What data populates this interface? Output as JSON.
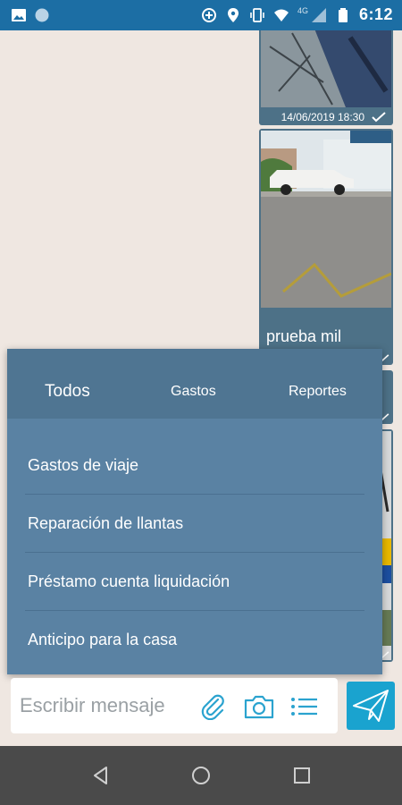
{
  "status_bar": {
    "time": "6:12",
    "network": "4G",
    "icons": [
      "image-icon",
      "circle-icon",
      "data-saver-icon",
      "location-icon",
      "vibrate-icon",
      "wifi-icon",
      "signal-icon",
      "battery-icon"
    ]
  },
  "messages": [
    {
      "type": "photo",
      "timestamp": "14/06/2019 18:30",
      "status": "sent-check"
    },
    {
      "type": "photo",
      "caption": "prueba mil",
      "status": "sent-check"
    },
    {
      "type": "photo",
      "status": "sent-check"
    },
    {
      "type": "photo",
      "status": "sent-check"
    }
  ],
  "popup": {
    "tabs": [
      {
        "label": "Todos",
        "selected": true
      },
      {
        "label": "Gastos",
        "selected": false
      },
      {
        "label": "Reportes",
        "selected": false
      }
    ],
    "items": [
      {
        "label": "Gastos de viaje"
      },
      {
        "label": "Reparación de llantas"
      },
      {
        "label": "Préstamo cuenta liquidación"
      },
      {
        "label": "Anticipo para la casa"
      }
    ]
  },
  "composer": {
    "placeholder": "Escribir mensaje",
    "value": ""
  },
  "colors": {
    "status_bar": "#1c6ea4",
    "chat_bg": "#efe7e1",
    "popup_bg": "#5a82a3",
    "tabs_bg": "#4f7592",
    "accent": "#1aa3cf",
    "nav_bg": "#4a4a4a"
  }
}
